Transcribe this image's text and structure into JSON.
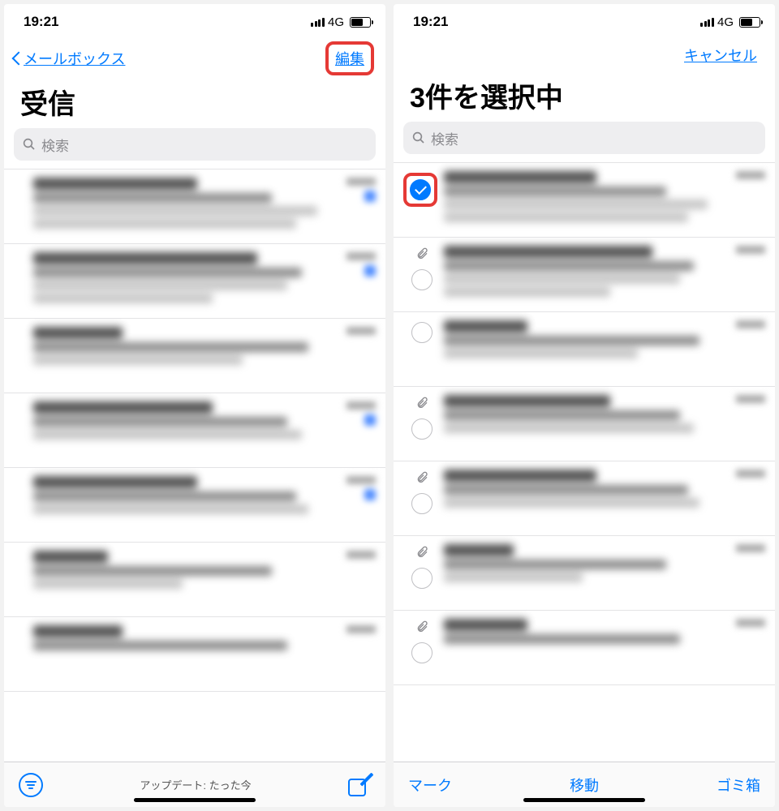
{
  "left": {
    "status": {
      "time": "19:21",
      "network": "4G"
    },
    "nav": {
      "back_label": "メールボックス",
      "edit_label": "編集"
    },
    "title": "受信",
    "search_placeholder": "検索",
    "footer": {
      "update_text": "アップデート: たった今"
    }
  },
  "right": {
    "status": {
      "time": "19:21",
      "network": "4G"
    },
    "nav": {
      "cancel_label": "キャンセル"
    },
    "title": "3件を選択中",
    "search_placeholder": "検索",
    "toolbar": {
      "mark": "マーク",
      "move": "移動",
      "trash": "ゴミ箱"
    },
    "items": [
      {
        "checked": true,
        "has_attachment": false
      },
      {
        "checked": false,
        "has_attachment": true
      },
      {
        "checked": false,
        "has_attachment": false
      },
      {
        "checked": false,
        "has_attachment": true
      },
      {
        "checked": false,
        "has_attachment": true
      },
      {
        "checked": false,
        "has_attachment": true
      },
      {
        "checked": false,
        "has_attachment": true
      }
    ]
  }
}
